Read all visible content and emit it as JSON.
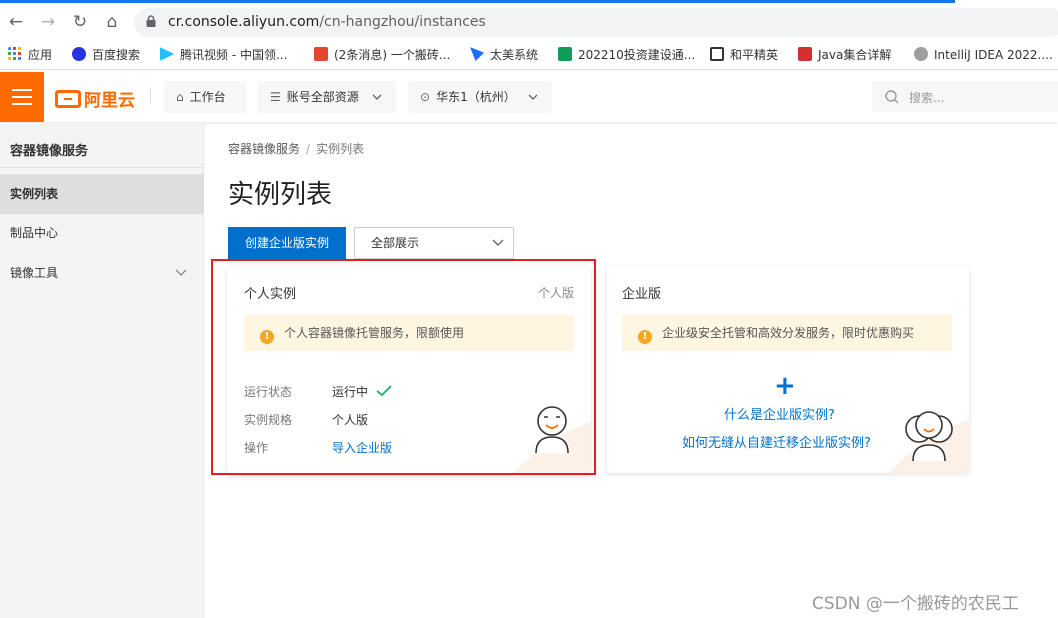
{
  "browser": {
    "url_host": "cr.console.aliyun.com",
    "url_path": "/cn-hangzhou/instances",
    "bookmarks": [
      {
        "label": "应用",
        "color": "#4285f4"
      },
      {
        "label": "百度搜索",
        "color": "#2932e1"
      },
      {
        "label": "腾讯视频 - 中国领...",
        "color": "#20c0ff"
      },
      {
        "label": "(2条消息) 一个搬砖...",
        "color": "#e3482d"
      },
      {
        "label": "太美系统",
        "color": "#1e6ff5"
      },
      {
        "label": "202210投资建设通...",
        "color": "#0f9d58"
      },
      {
        "label": "和平精英",
        "color": "#333333"
      },
      {
        "label": "Java集合详解",
        "color": "#d32f2f"
      },
      {
        "label": "IntelliJ IDEA 2022....",
        "color": "#9e9e9e"
      }
    ]
  },
  "topbar": {
    "logo_text": "阿里云",
    "workbench": "工作台",
    "resources": "账号全部资源",
    "region": "华东1（杭州）",
    "search_placeholder": "搜索..."
  },
  "sidebar": {
    "title": "容器镜像服务",
    "items": [
      {
        "label": "实例列表",
        "active": true
      },
      {
        "label": "制品中心",
        "active": false
      },
      {
        "label": "镜像工具",
        "active": false
      }
    ]
  },
  "main": {
    "breadcrumb": [
      "容器镜像服务",
      "实例列表"
    ],
    "title": "实例列表",
    "create_button": "创建企业版实例",
    "filter_select": "全部展示",
    "personal_card": {
      "title": "个人实例",
      "tag": "个人版",
      "notice": "个人容器镜像托管服务，限额使用",
      "rows": [
        {
          "label": "运行状态",
          "value": "运行中"
        },
        {
          "label": "实例规格",
          "value": "个人版"
        },
        {
          "label": "操作",
          "value": "导入企业版"
        }
      ]
    },
    "enterprise_card": {
      "title": "企业版",
      "notice": "企业级安全托管和高效分发服务，限时优惠购买",
      "plus": "+",
      "link1": "什么是企业版实例?",
      "link2": "如何无缝从自建迁移企业版实例?"
    }
  },
  "watermark": "CSDN @一个搬砖的农民工",
  "colors": {
    "accent": "#ff6a00",
    "primary": "#0070cc",
    "success": "#23b066",
    "highlight": "#e02020"
  }
}
